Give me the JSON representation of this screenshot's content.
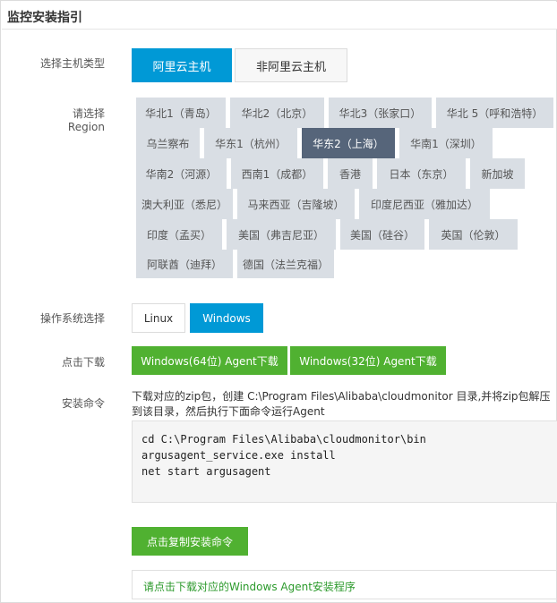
{
  "panel": {
    "title": "监控安装指引"
  },
  "host_type": {
    "label": "选择主机类型",
    "options": [
      "阿里云主机",
      "非阿里云主机"
    ],
    "selected": "阿里云主机"
  },
  "region": {
    "label": "请选择Region",
    "options": [
      "华北1（青岛）",
      "华北2（北京）",
      "华北3（张家口）",
      "华北 5（呼和浩特）",
      "乌兰察布",
      "华东1（杭州）",
      "华东2（上海）",
      "华南1（深圳）",
      "华南2（河源）",
      "西南1（成都）",
      "香港",
      "日本（东京）",
      "新加坡",
      "澳大利亚（悉尼）",
      "马来西亚（吉隆坡）",
      "印度尼西亚（雅加达）",
      "印度（孟买）",
      "美国（弗吉尼亚）",
      "美国（硅谷）",
      "英国（伦敦）",
      "阿联酋（迪拜）",
      "德国（法兰克福）"
    ],
    "selected": "华东2（上海）"
  },
  "os": {
    "label": "操作系统选择",
    "options": [
      "Linux",
      "Windows"
    ],
    "selected": "Windows"
  },
  "download": {
    "label": "点击下载",
    "buttons": [
      "Windows(64位) Agent下载",
      "Windows(32位) Agent下载"
    ]
  },
  "install": {
    "label": "安装命令",
    "description": "下载对应的zip包，创建 C:\\Program Files\\Alibaba\\cloudmonitor 目录,并将zip包解压到该目录，然后执行下面命令运行Agent",
    "commands": [
      "cd C:\\Program Files\\Alibaba\\cloudmonitor\\bin",
      "argusagent_service.exe install",
      "net start argusagent"
    ],
    "copy_button": "点击复制安装命令",
    "notice": "请点击下载对应的Windows Agent安装程序"
  },
  "colors": {
    "primary_blue": "#0099d6",
    "region_selected": "#56657a",
    "region_default": "#d9dee4",
    "action_green": "#50b131",
    "notice_text": "#2c9a2c"
  }
}
